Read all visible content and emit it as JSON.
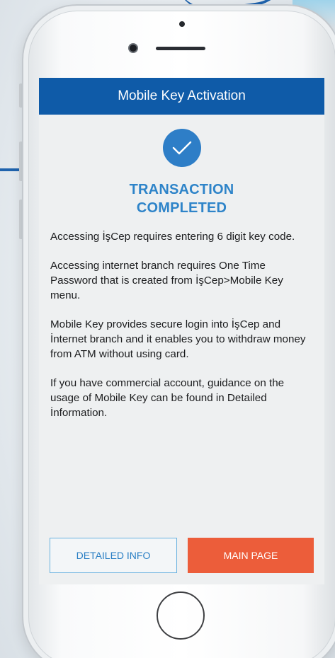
{
  "header": {
    "title": "Mobile Key Activation"
  },
  "status": {
    "line1": "TRANSACTION",
    "line2": "COMPLETED",
    "icon": "checkmark-circle-icon",
    "color": "#2e7ec7"
  },
  "body": {
    "paragraphs": [
      "Accessing İşCep requires entering 6 digit key code.",
      "Accessing internet branch requires One Time Password that is created from İşCep>Mobile Key menu.",
      "Mobile Key provides secure login into İşCep and İnternet branch and it enables you to withdraw money from ATM without using card.",
      "If you have commercial account, guidance on the usage of Mobile Key can be found in Detailed İnformation."
    ]
  },
  "buttons": {
    "detailed_info": "DETAILED INFO",
    "main_page": "MAIN PAGE"
  },
  "colors": {
    "header_bg": "#0f5ba8",
    "accent_blue": "#2e84c9",
    "main_button_bg": "#ec5d3a"
  }
}
